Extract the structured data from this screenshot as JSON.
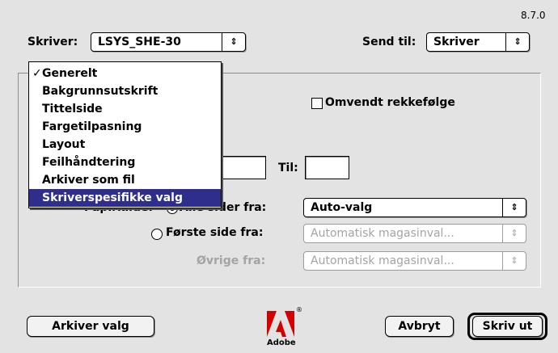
{
  "version": "8.7.0",
  "printer": {
    "label": "Skriver:",
    "value": "LSYS_SHE-30"
  },
  "destination": {
    "label": "Send til:",
    "value": "Skriver"
  },
  "menu": {
    "items": [
      {
        "label": "Generelt",
        "checked": true
      },
      {
        "label": "Bakgrunnsutskrift"
      },
      {
        "label": "Tittelside"
      },
      {
        "label": "Fargetilpasning"
      },
      {
        "label": "Layout"
      },
      {
        "label": "Feilhåndtering"
      },
      {
        "label": "Arkiver som fil"
      },
      {
        "label": "Skriverspesifikke valg",
        "selected": true
      }
    ]
  },
  "reverse_order": {
    "label": "Omvendt rekkefølge",
    "checked": false
  },
  "range": {
    "to_label": "Til:",
    "from_value": "",
    "to_value": ""
  },
  "paper_source": {
    "label": "Papirkilde:",
    "all_pages_label": "Alle sider fra:",
    "all_pages_value": "Auto-valg",
    "first_page_label": "Første side fra:",
    "first_page_value": "Automatisk magasinval...",
    "remaining_label": "Øvrige fra:",
    "remaining_value": "Automatisk magasinval...",
    "selected_option": "all"
  },
  "buttons": {
    "save": "Arkiver valg",
    "cancel": "Avbryt",
    "print": "Skriv ut"
  },
  "logo": {
    "text": "Adobe",
    "color": "#d40000"
  },
  "icons": {
    "popup_arrows": "⇕",
    "checkmark": "✓"
  }
}
